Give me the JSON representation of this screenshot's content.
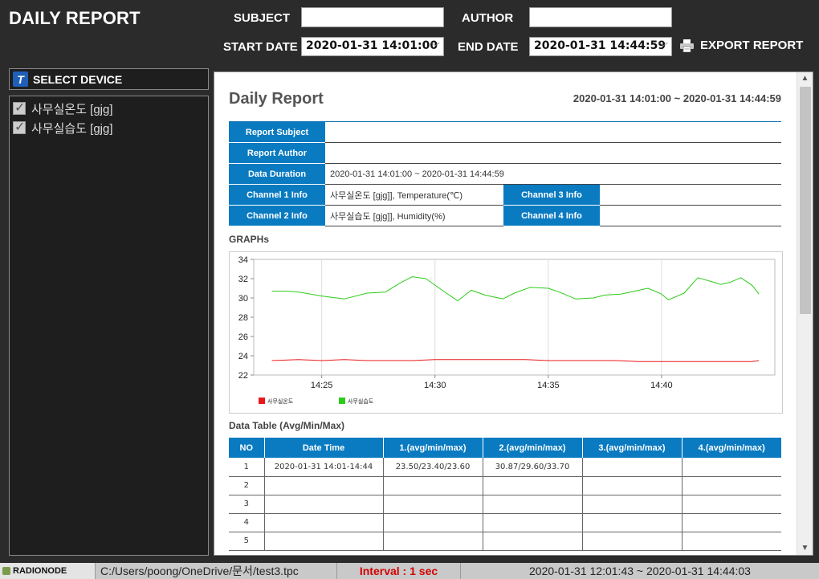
{
  "header": {
    "app_title": "DAILY REPORT",
    "subject_label": "SUBJECT",
    "subject_value": "",
    "author_label": "AUTHOR",
    "author_value": "",
    "start_date_label": "START DATE",
    "start_date_value": "2020-01-31 14:01:00",
    "end_date_label": "END DATE",
    "end_date_value": "2020-01-31 14:44:59",
    "export_label": "EXPORT REPORT"
  },
  "sidebar": {
    "logo_letter": "T",
    "title": "SELECT DEVICE",
    "devices": [
      {
        "label": "사무실온도 [gjg]",
        "checked": true
      },
      {
        "label": "사무실습도 [gjg]",
        "checked": true
      }
    ]
  },
  "report": {
    "title": "Daily Report",
    "range": "2020-01-31 14:01:00 ~ 2020-01-31 14:44:59",
    "info": {
      "subject_label": "Report Subject",
      "subject_value": "",
      "author_label": "Report Author",
      "author_value": "",
      "duration_label": "Data Duration",
      "duration_value": "2020-01-31 14:01:00 ~ 2020-01-31 14:44:59",
      "ch1_label": "Channel 1 Info",
      "ch1_value": "사무실온도 [gjg]], Temperature(℃)",
      "ch2_label": "Channel 2 Info",
      "ch2_value": "사무실습도 [gjg]], Humidity(%)",
      "ch3_label": "Channel 3 Info",
      "ch3_value": "",
      "ch4_label": "Channel 4 Info",
      "ch4_value": ""
    },
    "graphs_label": "GRAPHs",
    "table_label": "Data Table (Avg/Min/Max)",
    "table": {
      "headers": [
        "NO",
        "Date Time",
        "1.(avg/min/max)",
        "2.(avg/min/max)",
        "3.(avg/min/max)",
        "4.(avg/min/max)"
      ],
      "rows": [
        [
          "1",
          "2020-01-31 14:01-14:44",
          "23.50/23.40/23.60",
          "30.87/29.60/33.70",
          "",
          ""
        ],
        [
          "2",
          "",
          "",
          "",
          "",
          ""
        ],
        [
          "3",
          "",
          "",
          "",
          "",
          ""
        ],
        [
          "4",
          "",
          "",
          "",
          "",
          ""
        ],
        [
          "5",
          "",
          "",
          "",
          "",
          ""
        ]
      ]
    }
  },
  "chart_data": {
    "type": "line",
    "ylim": [
      22,
      34
    ],
    "yticks": [
      22,
      24,
      26,
      28,
      30,
      32,
      34
    ],
    "xlim": [
      22.0,
      45.0
    ],
    "xticks": [
      {
        "value": 25,
        "label": "14:25"
      },
      {
        "value": 30,
        "label": "14:30"
      },
      {
        "value": 35,
        "label": "14:35"
      },
      {
        "value": 40,
        "label": "14:40"
      }
    ],
    "grid": true,
    "legend_position": "bottom-left",
    "series": [
      {
        "name": "사무실온도",
        "color": "#e8191a",
        "x": [
          22.8,
          24.0,
          25.0,
          26.0,
          27.0,
          28.0,
          29.0,
          30.0,
          31.0,
          32.0,
          33.0,
          34.0,
          35.0,
          36.0,
          37.0,
          38.0,
          39.0,
          40.0,
          41.0,
          42.0,
          43.0,
          44.0,
          44.3
        ],
        "values": [
          23.5,
          23.6,
          23.5,
          23.6,
          23.5,
          23.5,
          23.5,
          23.6,
          23.6,
          23.6,
          23.6,
          23.6,
          23.5,
          23.5,
          23.5,
          23.5,
          23.4,
          23.4,
          23.4,
          23.4,
          23.4,
          23.4,
          23.5
        ]
      },
      {
        "name": "사무실습도",
        "color": "#2ccc18",
        "x": [
          22.8,
          23.5,
          24.0,
          25.0,
          26.0,
          27.0,
          27.8,
          28.5,
          29.0,
          29.6,
          30.5,
          31.0,
          31.6,
          32.2,
          33.0,
          33.5,
          34.2,
          35.0,
          35.5,
          36.2,
          37.0,
          37.5,
          38.2,
          39.0,
          39.4,
          40.0,
          40.3,
          41.0,
          41.6,
          42.2,
          42.6,
          43.0,
          43.5,
          44.0,
          44.3
        ],
        "values": [
          30.7,
          30.7,
          30.6,
          30.2,
          29.9,
          30.5,
          30.6,
          31.6,
          32.2,
          32.0,
          30.5,
          29.7,
          30.8,
          30.3,
          29.9,
          30.5,
          31.1,
          31.0,
          30.6,
          29.9,
          30.0,
          30.3,
          30.4,
          30.8,
          31.0,
          30.4,
          29.8,
          30.5,
          32.1,
          31.7,
          31.4,
          31.6,
          32.1,
          31.3,
          30.4
        ]
      }
    ]
  },
  "status_bar": {
    "logo_text": "RADIONODE",
    "path": "C:/Users/poong/OneDrive/문서/test3.tpc",
    "interval": "Interval : 1 sec",
    "range": "2020-01-31 12:01:43 ~ 2020-01-31 14:44:03"
  }
}
